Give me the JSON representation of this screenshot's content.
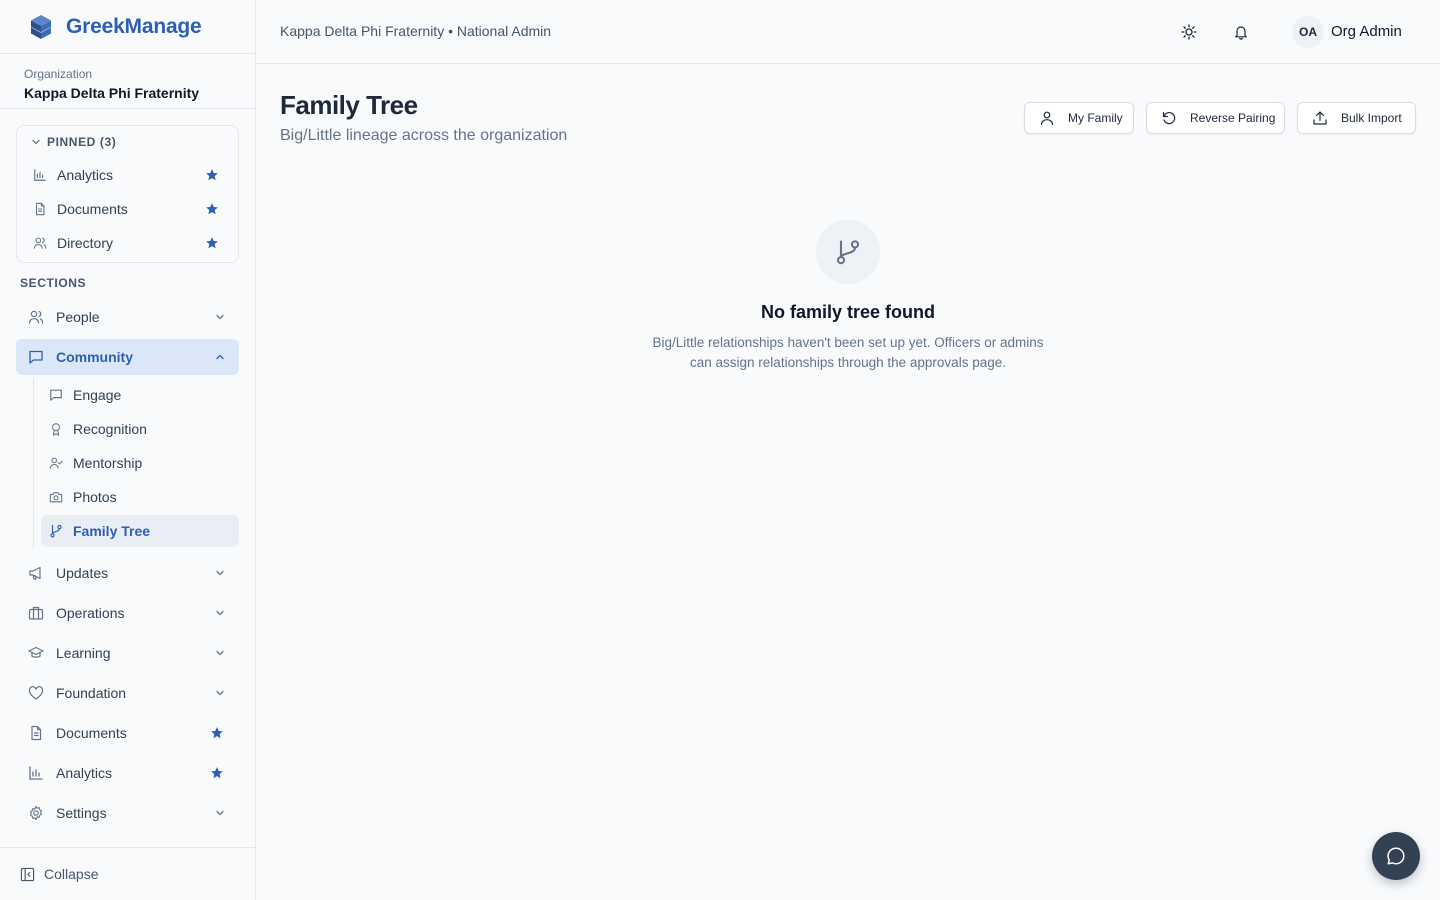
{
  "brand": {
    "name": "GreekManage",
    "color": "#2d5fb3"
  },
  "organization": {
    "label": "Organization",
    "name": "Kappa Delta Phi Fraternity"
  },
  "pinned": {
    "heading": "PINNED (3)",
    "items": [
      {
        "label": "Analytics",
        "icon": "bar-chart-icon",
        "starred": true
      },
      {
        "label": "Documents",
        "icon": "document-icon",
        "starred": true
      },
      {
        "label": "Directory",
        "icon": "users-icon",
        "starred": true
      }
    ]
  },
  "sidebar": {
    "sections_label": "SECTIONS",
    "items": [
      {
        "label": "People",
        "icon": "users-icon",
        "expandable": true
      },
      {
        "label": "Community",
        "icon": "chat-icon",
        "expanded": true,
        "active": true
      },
      {
        "label": "Updates",
        "icon": "megaphone-icon",
        "expandable": true
      },
      {
        "label": "Operations",
        "icon": "briefcase-icon",
        "expandable": true
      },
      {
        "label": "Learning",
        "icon": "graduation-cap-icon",
        "expandable": true
      },
      {
        "label": "Foundation",
        "icon": "heart-icon",
        "expandable": true
      },
      {
        "label": "Documents",
        "icon": "document-icon",
        "starred": true
      },
      {
        "label": "Analytics",
        "icon": "bar-chart-icon",
        "starred": true
      },
      {
        "label": "Settings",
        "icon": "gear-icon",
        "expandable": true
      }
    ],
    "community_sub": [
      {
        "label": "Engage",
        "icon": "chat-icon"
      },
      {
        "label": "Recognition",
        "icon": "award-icon"
      },
      {
        "label": "Mentorship",
        "icon": "user-check-icon"
      },
      {
        "label": "Photos",
        "icon": "camera-icon"
      },
      {
        "label": "Family Tree",
        "icon": "git-branch-icon",
        "active": true
      }
    ],
    "collapse_label": "Collapse"
  },
  "header": {
    "breadcrumb": "Kappa Delta Phi Fraternity • National Admin",
    "avatar_initials": "OA",
    "user_name": "Org Admin"
  },
  "page": {
    "title": "Family Tree",
    "subtitle": "Big/Little lineage across the organization",
    "buttons": {
      "my_family": "My Family",
      "reverse_pairing": "Reverse Pairing",
      "bulk_import": "Bulk Import"
    },
    "empty_state": {
      "title": "No family tree found",
      "description": "Big/Little relationships haven't been set up yet. Officers or admins can assign relationships through the approvals page."
    }
  },
  "colors": {
    "accent": "#2d5fb3",
    "active_bg": "#dbe7f7",
    "fab": "#334155"
  }
}
